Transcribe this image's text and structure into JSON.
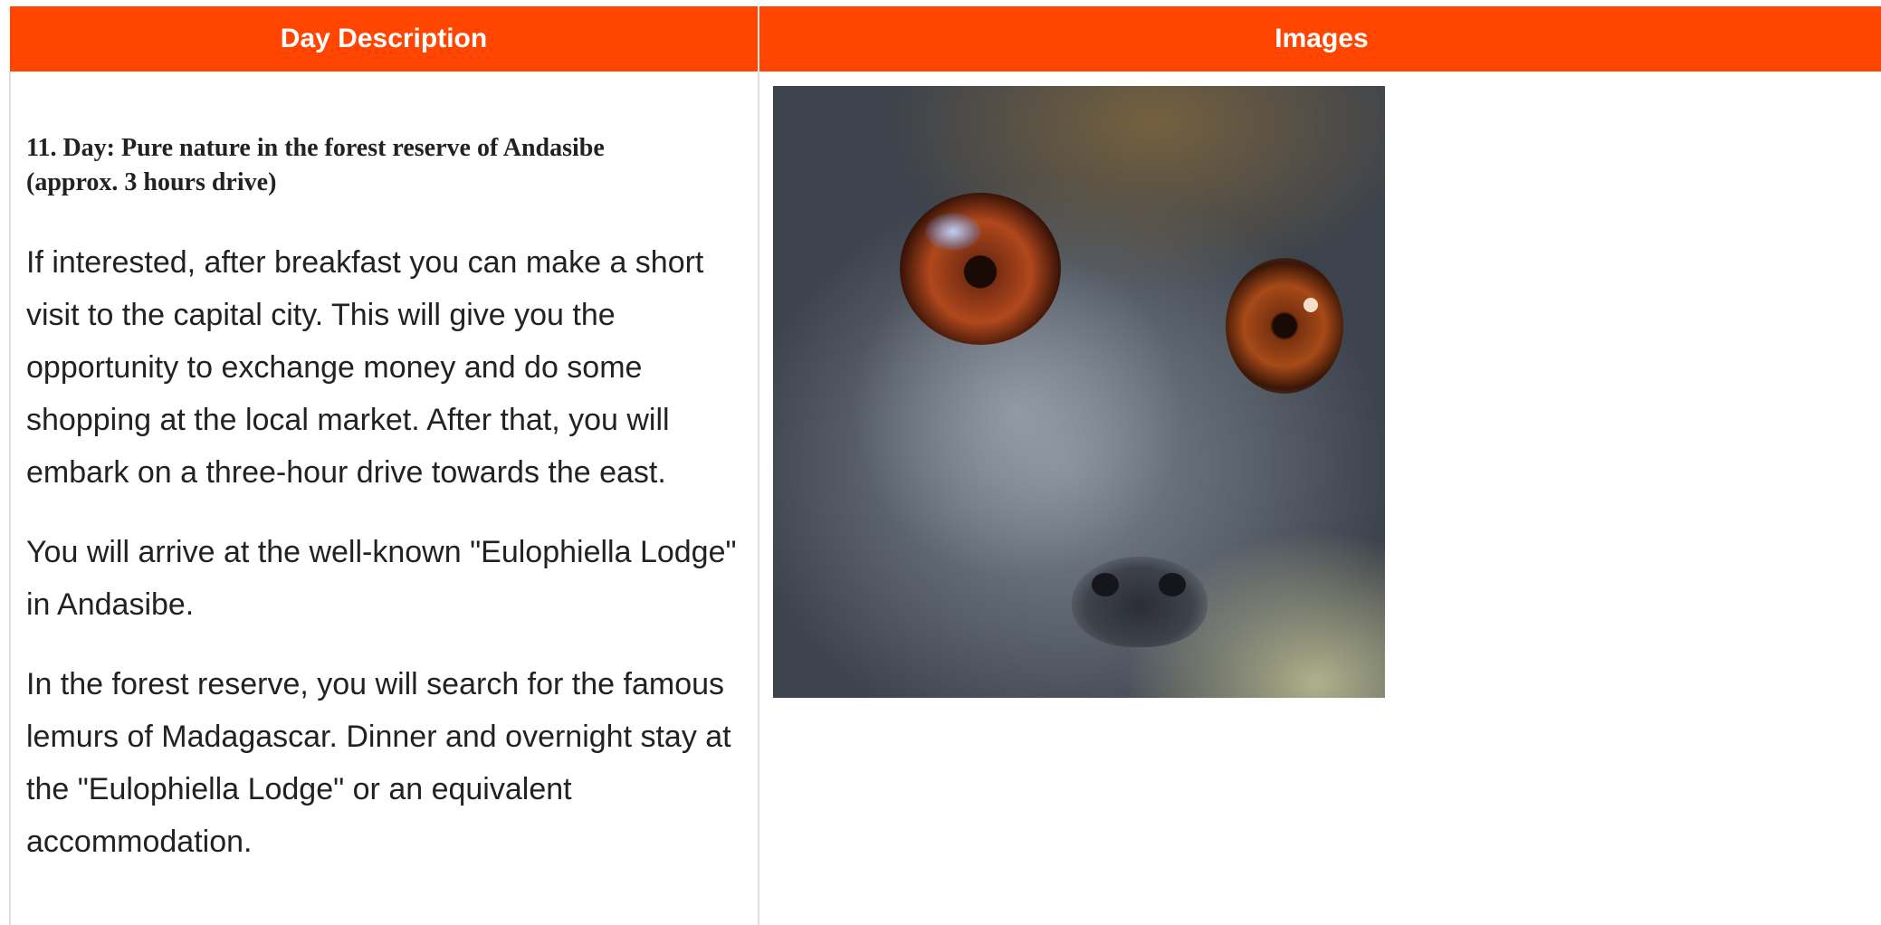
{
  "table": {
    "headers": {
      "description": "Day Description",
      "images": "Images"
    },
    "rows": [
      {
        "day_title_line1": "11. Day: Pure nature in the forest reserve of Andasibe",
        "day_title_line2": "(approx. 3 hours drive)",
        "paragraphs": [
          "If interested, after breakfast you can make a short visit to the capital city. This will give you the opportunity to exchange money and do some shopping at the local market. After that, you will embark on a three-hour drive towards the east.",
          "You will arrive at the well-known \"Eulophiella Lodge\" in Andasibe.",
          "In the forest reserve, you will search for the famous lemurs of Madagascar. Dinner and overnight stay at the \"Eulophiella Lodge\" or an equivalent accommodation."
        ]
      }
    ]
  },
  "colors": {
    "header_background": "#ff4500",
    "header_text": "#ffffff",
    "body_text": "#222222"
  }
}
